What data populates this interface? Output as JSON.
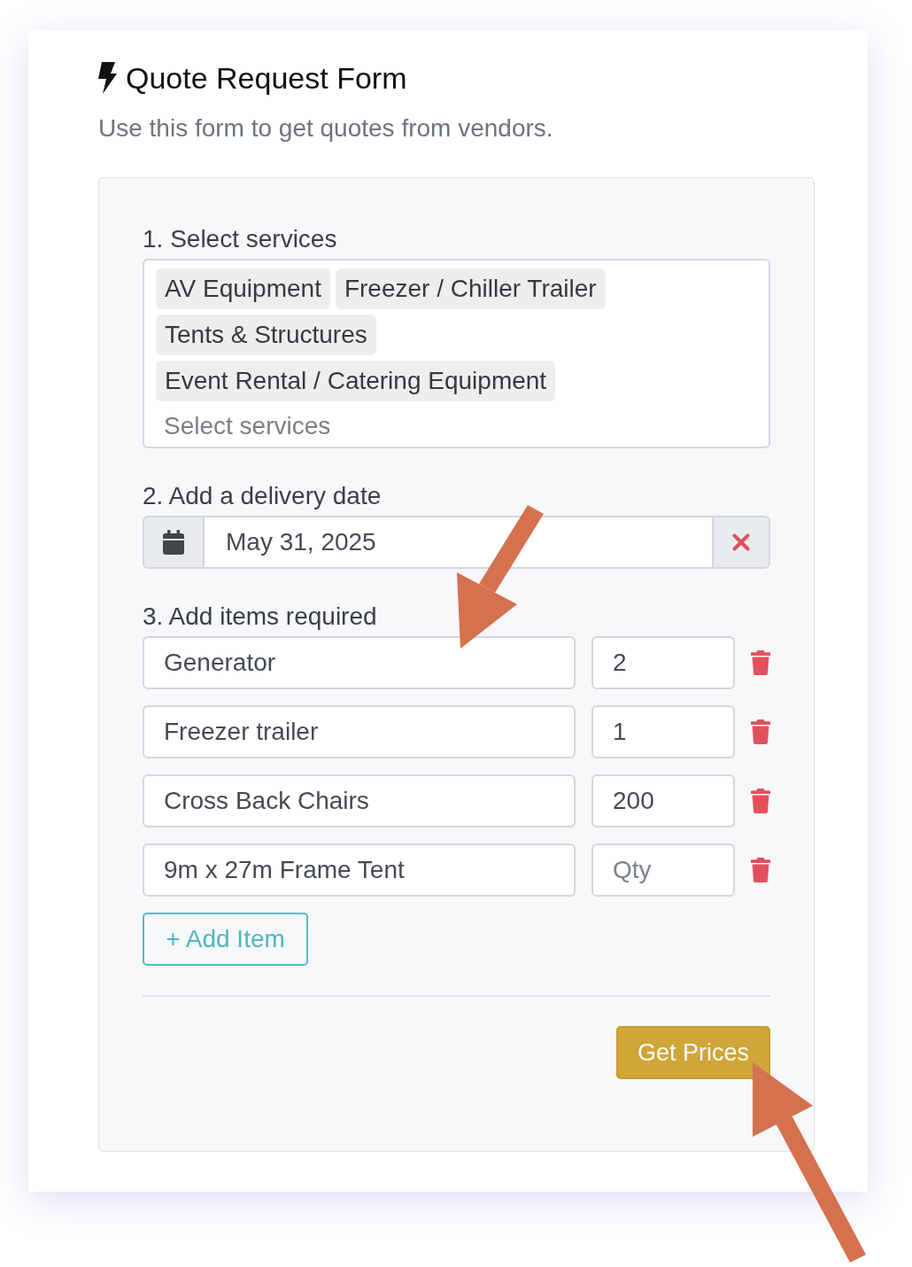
{
  "form": {
    "title": "Quote Request Form",
    "subtitle": "Use this form to get quotes from vendors."
  },
  "services": {
    "label": "1. Select services",
    "tags": [
      "AV Equipment",
      "Freezer / Chiller Trailer",
      "Tents & Structures",
      "Event Rental / Catering Equipment"
    ],
    "placeholder": "Select services"
  },
  "delivery_date": {
    "label": "2. Add a delivery date",
    "value": "May 31, 2025"
  },
  "items": {
    "label": "3. Add items required",
    "rows": [
      {
        "name": "Generator",
        "quantity": {
          "value": "2"
        }
      },
      {
        "name": "Freezer trailer",
        "quantity": {
          "value": "1"
        }
      },
      {
        "name": "Cross Back Chairs",
        "quantity": {
          "value": "200"
        }
      },
      {
        "name": "9m x 27m Frame Tent",
        "quantity": {
          "placeholder": "Qty"
        }
      }
    ],
    "add_button": "+ Add Item"
  },
  "submit_button": "Get Prices"
}
